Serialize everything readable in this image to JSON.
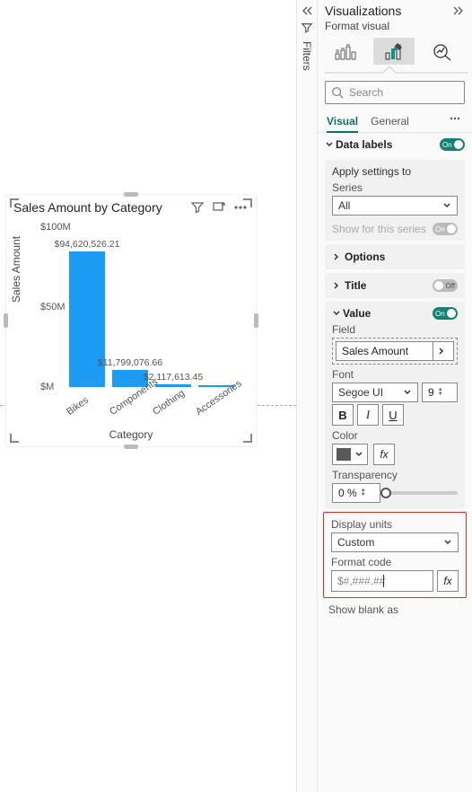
{
  "chart_data": {
    "type": "bar",
    "title": "Sales Amount by Category",
    "xlabel": "Category",
    "ylabel": "Sales Amount",
    "ylim": [
      0,
      100000000
    ],
    "yticks": [
      {
        "value": 0,
        "label": "$M",
        "frac": 0.0
      },
      {
        "value": 50000000,
        "label": "$50M",
        "frac": 0.5
      },
      {
        "value": 100000000,
        "label": "$100M",
        "frac": 1.0
      }
    ],
    "categories": [
      "Bikes",
      "Components",
      "Clothing",
      "Accessories"
    ],
    "values": [
      94620526.21,
      11799076.66,
      2117613.45,
      700000
    ],
    "data_labels": [
      "$94,620,526.21",
      "$11,799,076.66",
      "$2,117,613.45",
      ""
    ],
    "bar_color": "#1c9bf4"
  },
  "filters": {
    "label": "Filters"
  },
  "panel": {
    "title": "Visualizations",
    "subtitle": "Format visual",
    "search_placeholder": "Search",
    "tabs": {
      "visual": "Visual",
      "general": "General"
    },
    "sections": {
      "data_labels": {
        "label": "Data labels",
        "on": true
      },
      "apply": {
        "title": "Apply settings to",
        "series_label": "Series",
        "series_value": "All",
        "show_for_series": "Show for this series"
      },
      "options": {
        "label": "Options"
      },
      "title_collapse": {
        "label": "Title",
        "on": false
      },
      "value": {
        "label": "Value",
        "on": true,
        "field_label": "Field",
        "field_value": "Sales Amount",
        "font_label": "Font",
        "font_family": "Segoe UI",
        "font_size": "9",
        "bold": "B",
        "italic": "I",
        "underline": "U",
        "color_label": "Color",
        "color_hex": "#595959",
        "transparency_label": "Transparency",
        "transparency_value": "0 %"
      },
      "display_units": {
        "label": "Display units",
        "value": "Custom"
      },
      "format_code": {
        "label": "Format code",
        "value": "$#,###.##"
      },
      "show_blank": "Show blank as"
    }
  }
}
